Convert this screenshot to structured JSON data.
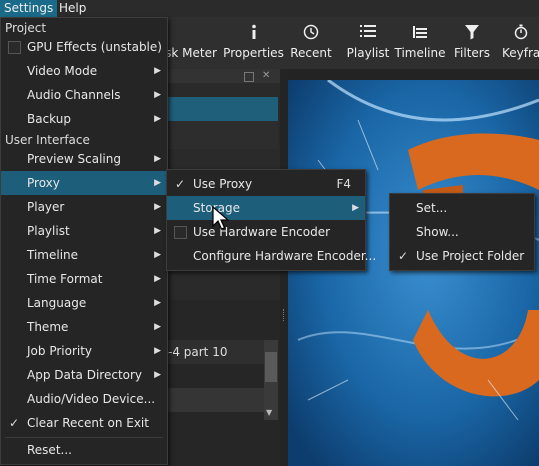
{
  "menubar": {
    "settings": "Settings",
    "help": "Help"
  },
  "toolbar": [
    {
      "label": "sk Meter",
      "icon": "task-meter-icon"
    },
    {
      "label": "Properties",
      "icon": "info-icon"
    },
    {
      "label": "Recent",
      "icon": "clock-icon"
    },
    {
      "label": "Playlist",
      "icon": "list-icon"
    },
    {
      "label": "Timeline",
      "icon": "timeline-icon"
    },
    {
      "label": "Filters",
      "icon": "filter-icon"
    },
    {
      "label": "Keyfran",
      "icon": "stopwatch-icon"
    }
  ],
  "playlist_row": "-4 part 10",
  "settings_menu": {
    "section_project": "Project",
    "gpu_effects": "GPU Effects (unstable)",
    "video_mode": "Video Mode",
    "audio_channels": "Audio Channels",
    "backup": "Backup",
    "section_ui": "User Interface",
    "preview_scaling": "Preview Scaling",
    "proxy": "Proxy",
    "player": "Player",
    "playlist": "Playlist",
    "timeline": "Timeline",
    "time_format": "Time Format",
    "language": "Language",
    "theme": "Theme",
    "job_priority": "Job Priority",
    "app_data_directory": "App Data Directory",
    "audio_video_device": "Audio/Video Device...",
    "clear_recent": "Clear Recent on Exit",
    "reset": "Reset..."
  },
  "proxy_menu": {
    "use_proxy": "Use Proxy",
    "use_proxy_shortcut": "F4",
    "storage": "Storage",
    "use_hw_encoder": "Use Hardware Encoder",
    "configure_hw_encoder": "Configure Hardware Encoder..."
  },
  "storage_menu": {
    "set": "Set...",
    "show": "Show...",
    "use_project_folder": "Use Project Folder"
  },
  "colors": {
    "accent": "#1d5e7b",
    "menu_bg": "#252525"
  }
}
